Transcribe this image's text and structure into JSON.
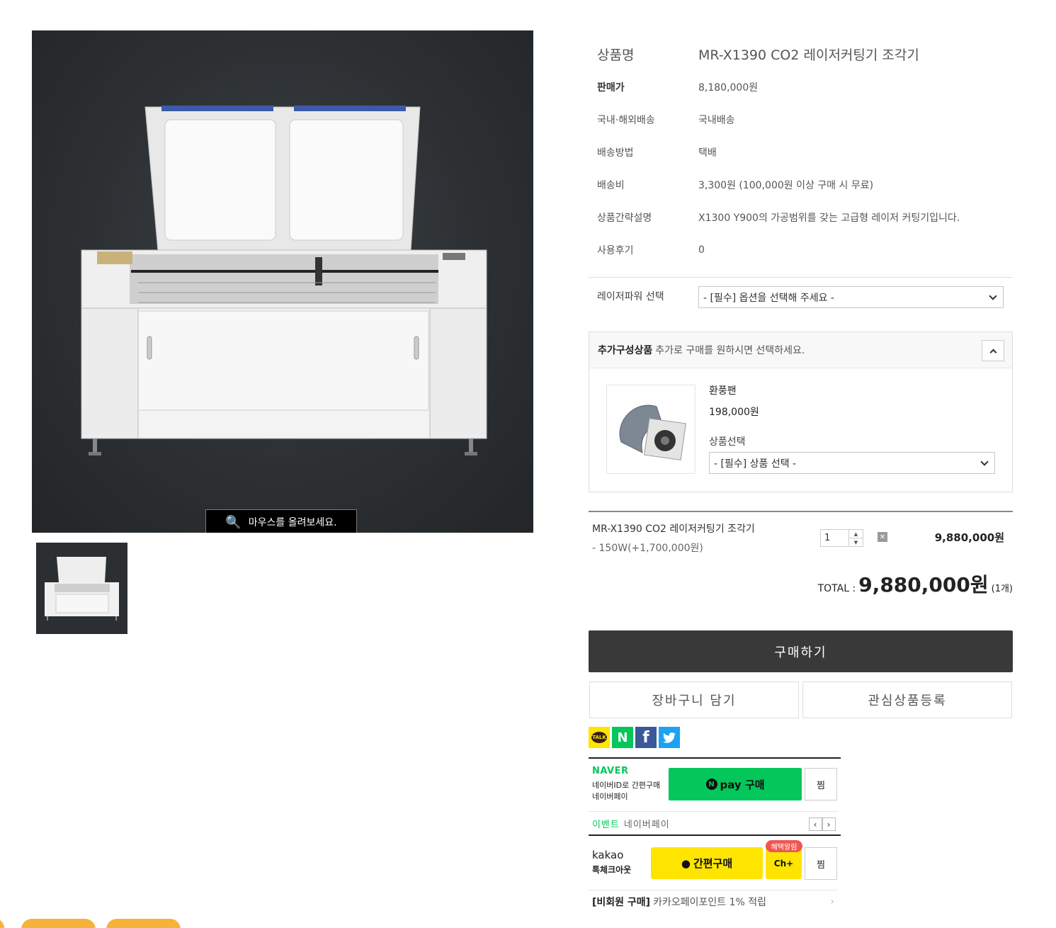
{
  "zoom_hint": "마우스를 올려보세요.",
  "product": {
    "name_label": "상품명",
    "name": "MR-X1390 CO2 레이저커팅기 조각기",
    "rows": [
      {
        "label": "판매가",
        "value": "8,180,000원"
      },
      {
        "label": "국내·해외배송",
        "value": "국내배송"
      },
      {
        "label": "배송방법",
        "value": "택배"
      },
      {
        "label": "배송비",
        "value": "3,300원 (100,000원 이상 구매 시 무료)"
      },
      {
        "label": "상품간략설명",
        "value": "X1300 Y900의 가공범위를 갖는 고급형 레이저 커팅기입니다."
      },
      {
        "label": "사용후기",
        "value": "0"
      }
    ]
  },
  "option": {
    "label": "레이저파워 선택",
    "placeholder": "- [필수] 옵션을 선택해 주세요 -"
  },
  "addon": {
    "title": "추가구성상품",
    "desc": "추가로 구매를 원하시면 선택하세요.",
    "item_name": "환풍팬",
    "item_price": "198,000원",
    "select_label": "상품선택",
    "select_placeholder": "- [필수] 상품 선택 -"
  },
  "selected": {
    "name": "MR-X1390 CO2 레이저커팅기 조각기",
    "option": "- 150W(+1,700,000원)",
    "qty": "1",
    "price": "9,880,000원"
  },
  "total": {
    "label": "TOTAL :",
    "amount": "9,880,000원",
    "count": "(1개)"
  },
  "buttons": {
    "buy": "구매하기",
    "cart": "장바구니 담기",
    "wish": "관심상품등록"
  },
  "share_icons": [
    "kakaotalk-icon",
    "naver-icon",
    "facebook-icon",
    "twitter-icon"
  ],
  "share_labels": {
    "kakaotalk": "TALK",
    "naver": "N",
    "facebook": "f"
  },
  "npay": {
    "logo": "NAVER",
    "sub1": "네이버ID로 간편구매",
    "sub2": "네이버페이",
    "button": "pay 구매",
    "zzim": "찜",
    "event_label": "이벤트",
    "event_text": "네이버페이"
  },
  "kakao": {
    "logo": "kakao",
    "sub": "톡체크아웃",
    "button": "간편구매",
    "badge": "혜택알림",
    "ch": "Ch+",
    "zzim": "찜",
    "point_bold": "[비회원 구매]",
    "point_text": "카카오페이포인트 1% 적립"
  },
  "colors": {
    "naver_green": "#03c75a",
    "kakao_yellow": "#fee500",
    "buy_button": "#393939"
  }
}
